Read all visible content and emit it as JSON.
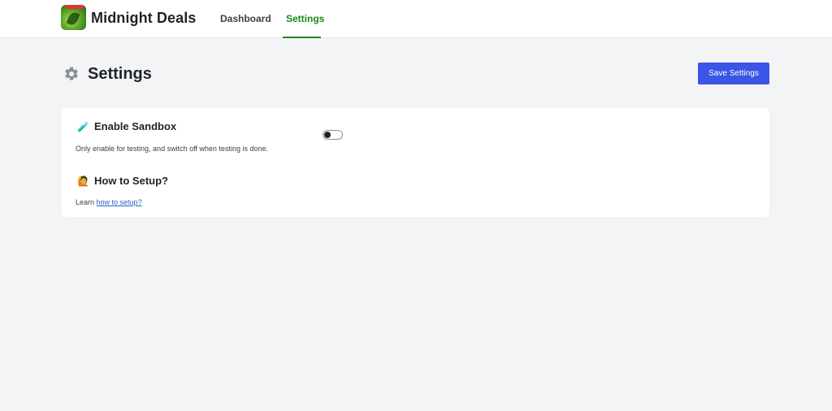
{
  "header": {
    "brand": "Midnight Deals",
    "tabs": [
      {
        "label": "Dashboard",
        "active": false
      },
      {
        "label": "Settings",
        "active": true
      }
    ],
    "active_color": "#1a8a1a",
    "logo_icon": "app-logo-icon"
  },
  "page": {
    "title": "Settings",
    "title_icon": "gear-icon",
    "save_label": "Save Settings",
    "accent": "#3b55e6"
  },
  "sandbox": {
    "emoji": "🧪",
    "title": "Enable Sandbox",
    "description": "Only enable for testing, and switch off when testing is done.",
    "enabled": false
  },
  "setup": {
    "emoji": "🙋",
    "title": "How to Setup?",
    "learn_prefix": "Learn ",
    "link_text": "how to setup?"
  }
}
